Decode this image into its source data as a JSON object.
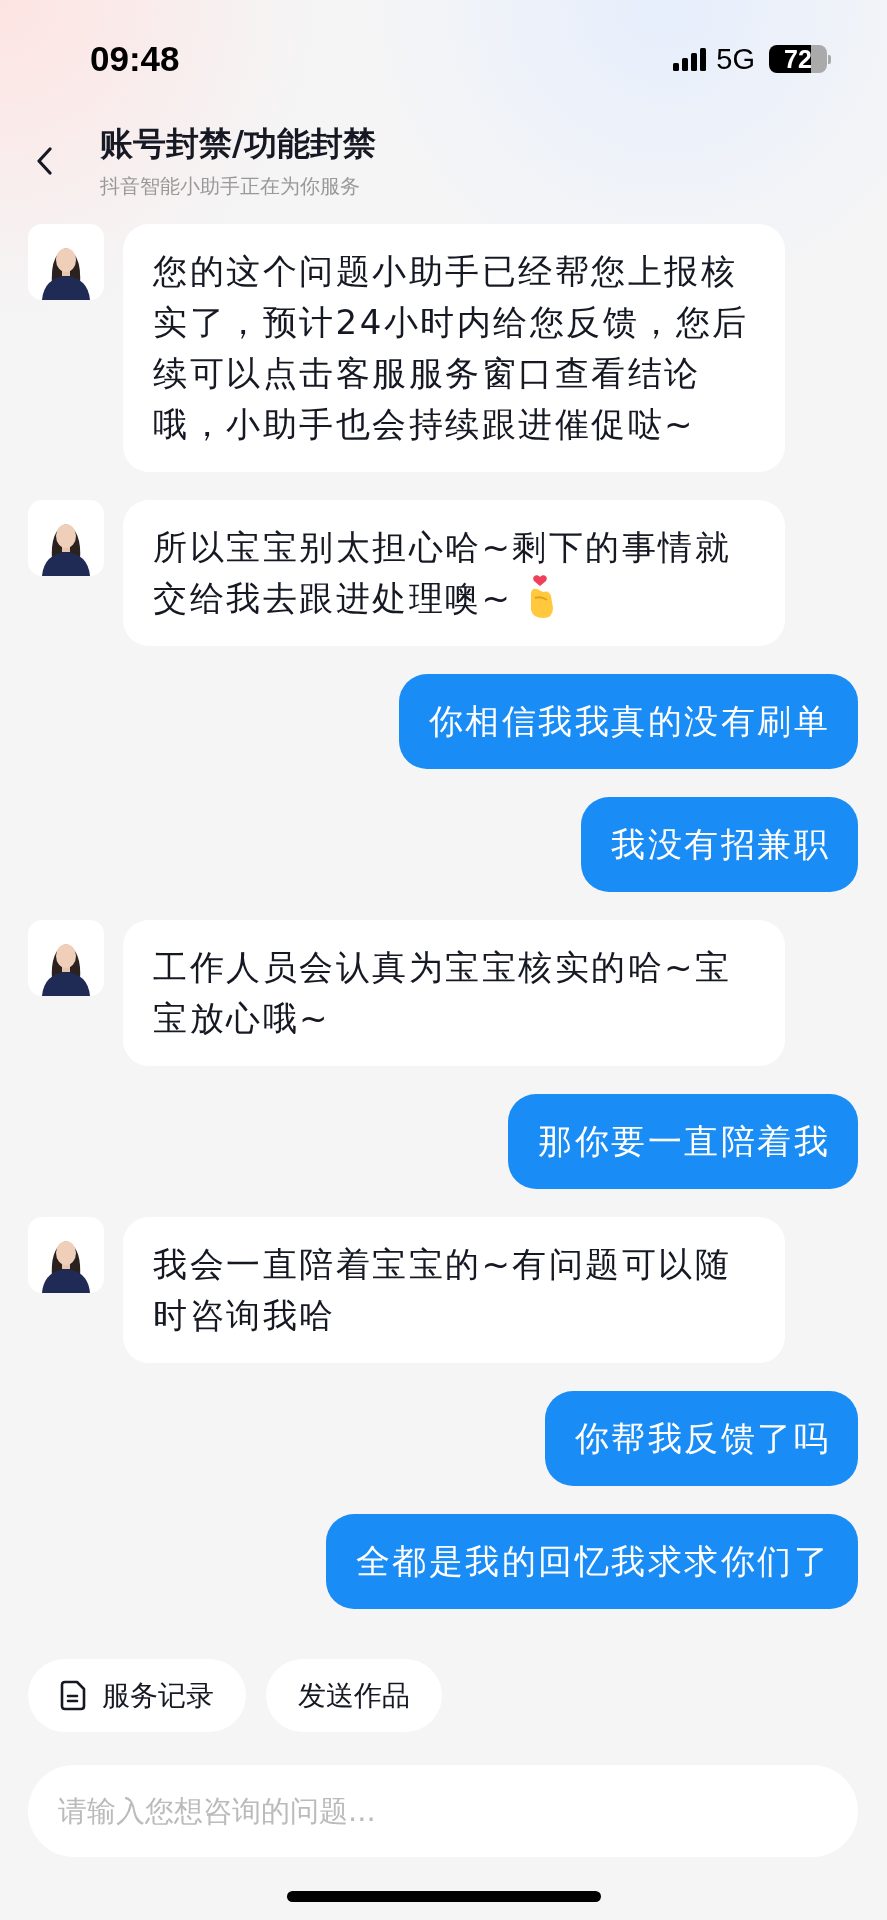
{
  "status_bar": {
    "time": "09:48",
    "network": "5G",
    "battery": "72"
  },
  "header": {
    "title": "账号封禁/功能封禁",
    "subtitle": "抖音智能小助手正在为你服务"
  },
  "messages": [
    {
      "kind": "bot",
      "text": "您的这个问题小助手已经帮您上报核实了，预计24小时内给您反馈，您后续可以点击客服服务窗口查看结论哦，小助手也会持续跟进催促哒~"
    },
    {
      "kind": "bot",
      "text": "所以宝宝别太担心哈~剩下的事情就交给我去跟进处理噢~",
      "sticker": {
        "kind": "finger_heart"
      }
    },
    {
      "kind": "user",
      "text": "你相信我我真的没有刷单"
    },
    {
      "kind": "user",
      "text": "我没有招兼职"
    },
    {
      "kind": "bot",
      "text": "工作人员会认真为宝宝核实的哈~宝宝放心哦~"
    },
    {
      "kind": "user",
      "text": "那你要一直陪着我"
    },
    {
      "kind": "bot",
      "text": "我会一直陪着宝宝的~有问题可以随时咨询我哈"
    },
    {
      "kind": "user",
      "text": "你帮我反馈了吗"
    },
    {
      "kind": "user",
      "text": "全都是我的回忆我求求你们了"
    }
  ],
  "quick_actions": [
    {
      "label": "服务记录",
      "kind": "document"
    },
    {
      "label": "发送作品",
      "kind": "plain"
    }
  ],
  "input": {
    "placeholder": "请输入您想咨询的问题..."
  }
}
